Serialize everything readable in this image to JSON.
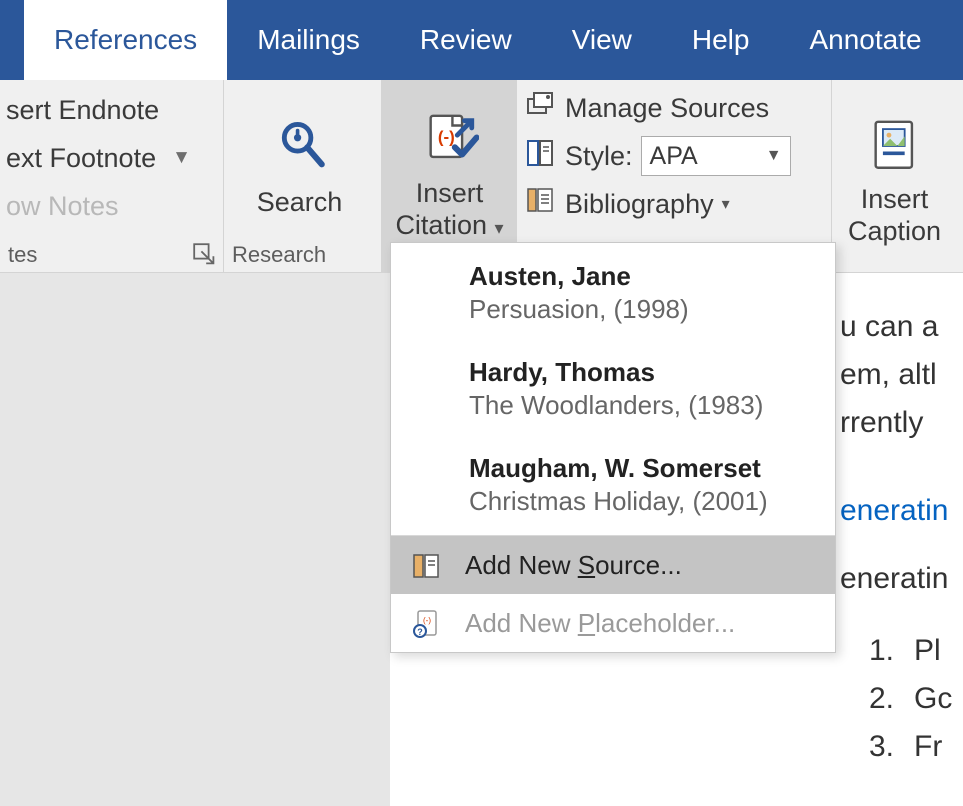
{
  "tabs": {
    "references": "References",
    "mailings": "Mailings",
    "review": "Review",
    "view": "View",
    "help": "Help",
    "annotate": "Annotate"
  },
  "footnotes": {
    "insert_endnote": "sert Endnote",
    "next_footnote": "ext Footnote",
    "show_notes": "ow Notes",
    "group_label": "tes"
  },
  "research": {
    "search": "Search",
    "group_label": "Research"
  },
  "citation": {
    "insert_citation_l1": "Insert",
    "insert_citation_l2": "Citation",
    "manage_sources": "Manage Sources",
    "style_label": "Style:",
    "style_value": "APA",
    "bibliography": "Bibliography"
  },
  "caption": {
    "l1": "Insert",
    "l2": "Caption"
  },
  "citation_menu": {
    "sources": [
      {
        "author": "Austen, Jane",
        "title": "Persuasion, (1998)"
      },
      {
        "author": "Hardy, Thomas",
        "title": "The Woodlanders, (1983)"
      },
      {
        "author": "Maugham, W. Somerset",
        "title": "Christmas Holiday, (2001)"
      }
    ],
    "add_new_source_pre": "Add New ",
    "add_new_source_u": "S",
    "add_new_source_post": "ource...",
    "add_new_ph_pre": "Add New ",
    "add_new_ph_u": "P",
    "add_new_ph_post": "laceholder..."
  },
  "document": {
    "line1": "u can a",
    "line2": "em, altl",
    "line3": "rrently",
    "link_line": "eneratin",
    "line5": "eneratin",
    "list": [
      "Pl",
      "Gc",
      "Fr"
    ]
  }
}
